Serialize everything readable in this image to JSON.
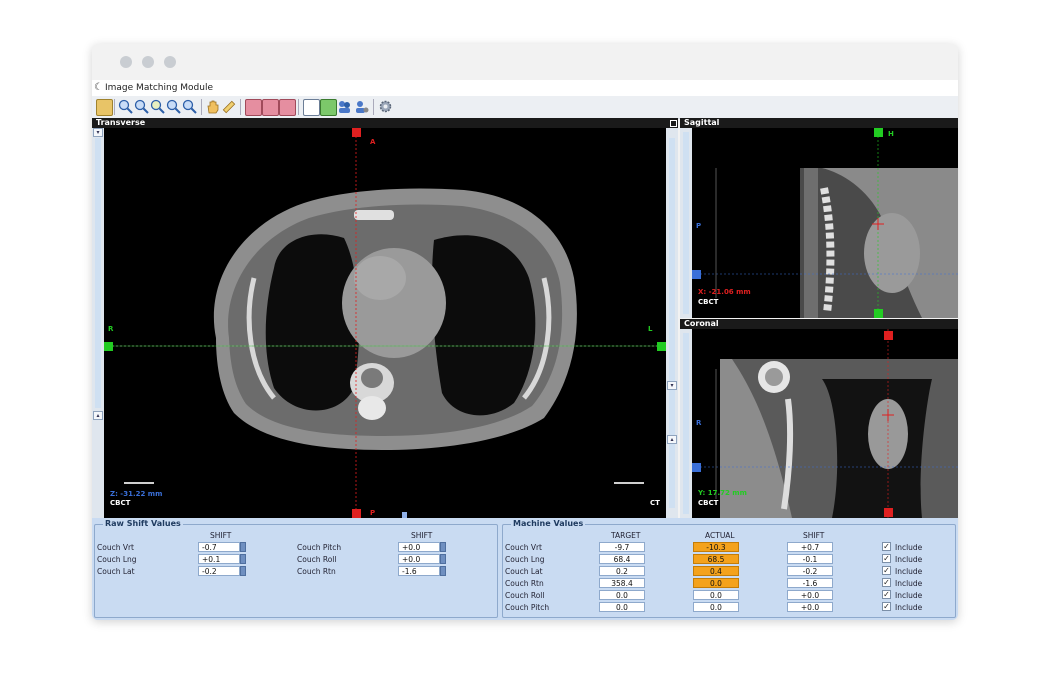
{
  "window": {
    "app_title": "Image Matching Module"
  },
  "views": {
    "transverse": {
      "title": "Transverse",
      "orient_top": "A",
      "orient_bottom": "P",
      "orient_left": "R",
      "orient_right": "L",
      "position": "Z: -31.22 mm",
      "series": "CBCT",
      "ref_series": "CT"
    },
    "sagittal": {
      "title": "Sagittal",
      "orient_top": "H",
      "orient_left": "P",
      "position": "X: -21.06 mm",
      "series": "CBCT"
    },
    "coronal": {
      "title": "Coronal",
      "orient_left": "R",
      "position": "Y: 17.72 mm",
      "series": "CBCT"
    }
  },
  "raw_shift": {
    "title": "Raw Shift Values",
    "shift_header": "SHIFT",
    "rows_left": [
      {
        "label": "Couch Vrt",
        "value": "-0.7"
      },
      {
        "label": "Couch Lng",
        "value": "+0.1"
      },
      {
        "label": "Couch Lat",
        "value": "-0.2"
      }
    ],
    "rows_right": [
      {
        "label": "Couch Pitch",
        "value": "+0.0"
      },
      {
        "label": "Couch Roll",
        "value": "+0.0"
      },
      {
        "label": "Couch Rtn",
        "value": "-1.6"
      }
    ]
  },
  "machine": {
    "title": "Machine Values",
    "headers": {
      "target": "TARGET",
      "actual": "ACTUAL",
      "shift": "SHIFT"
    },
    "include_label": "Include",
    "rows": [
      {
        "label": "Couch Vrt",
        "target": "-9.7",
        "actual": "-10.3",
        "shift": "+0.7",
        "highlight": true
      },
      {
        "label": "Couch Lng",
        "target": "68.4",
        "actual": "68.5",
        "shift": "-0.1",
        "highlight": true
      },
      {
        "label": "Couch Lat",
        "target": "0.2",
        "actual": "0.4",
        "shift": "-0.2",
        "highlight": true
      },
      {
        "label": "Couch Rtn",
        "target": "358.4",
        "actual": "0.0",
        "shift": "-1.6",
        "highlight": true
      },
      {
        "label": "Couch Roll",
        "target": "0.0",
        "actual": "0.0",
        "shift": "+0.0",
        "highlight": false
      },
      {
        "label": "Couch Pitch",
        "target": "0.0",
        "actual": "0.0",
        "shift": "+0.0",
        "highlight": false
      }
    ]
  },
  "colors": {
    "highlight": "#f4a21c",
    "crosshair_red": "#e02020",
    "crosshair_green": "#22cc22",
    "crosshair_blue": "#3a6fd8"
  }
}
